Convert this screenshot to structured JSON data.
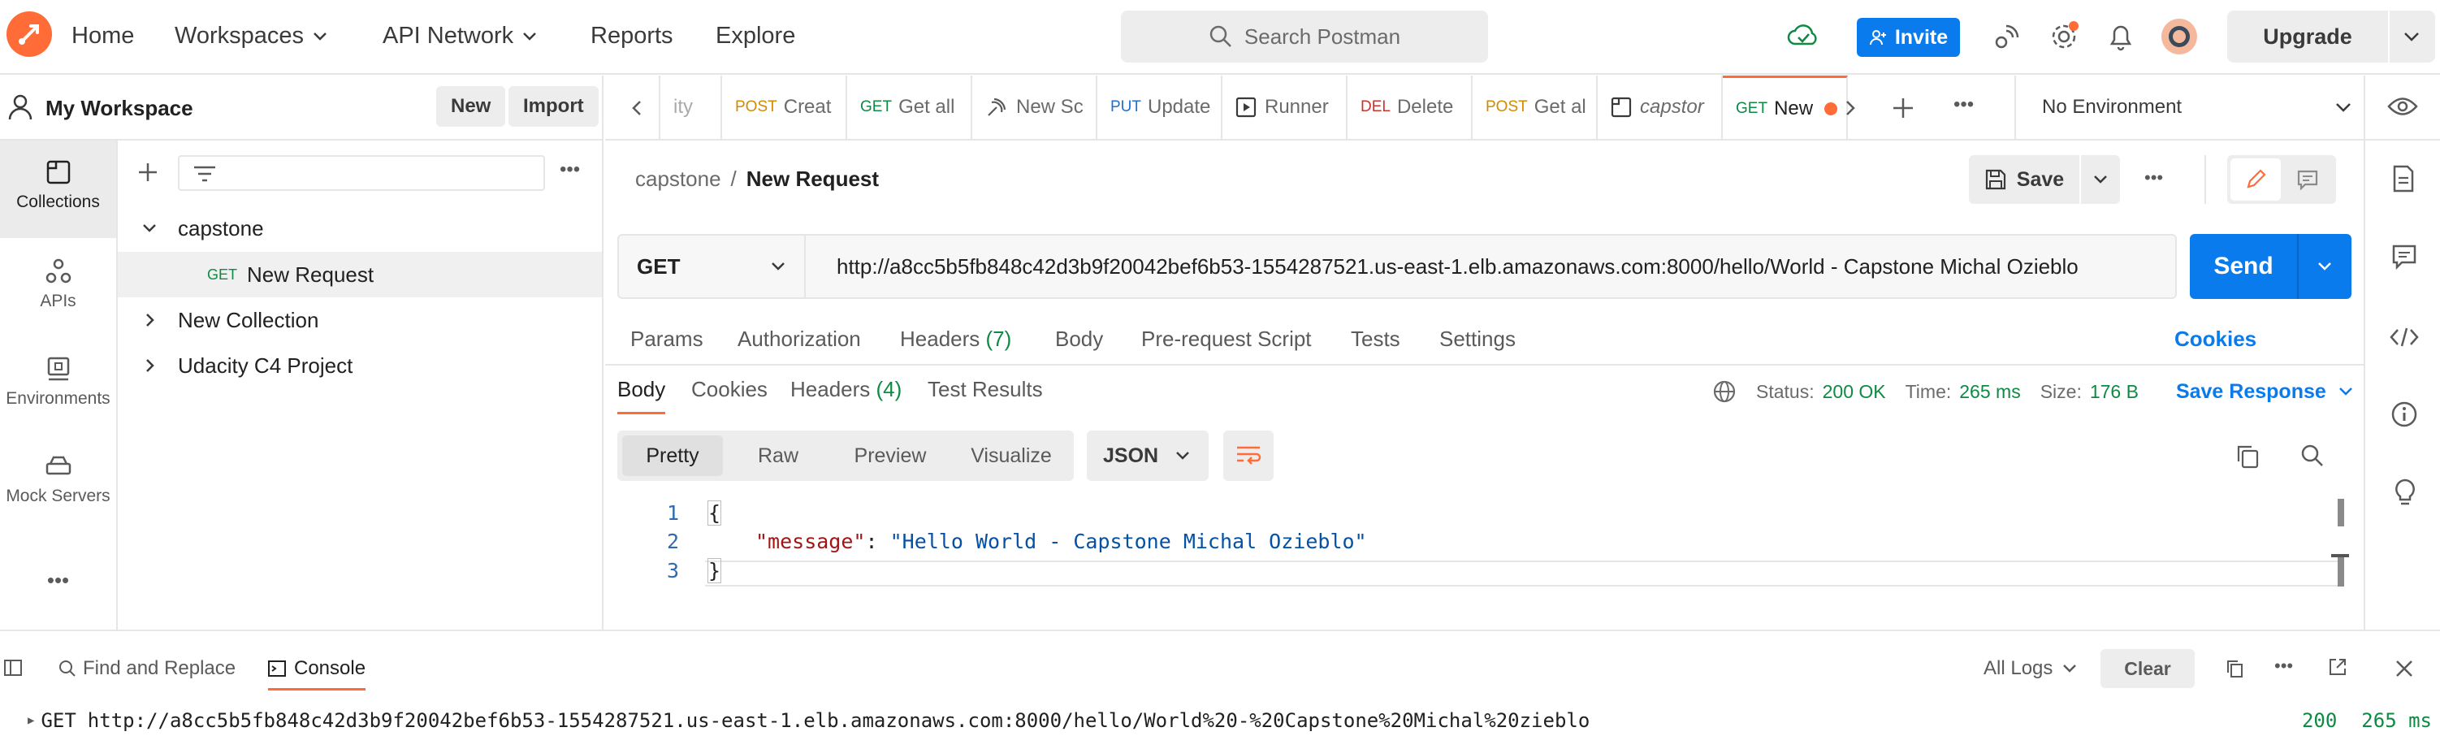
{
  "topbar": {
    "nav": [
      "Home",
      "Workspaces",
      "API Network",
      "Reports",
      "Explore"
    ],
    "search_placeholder": "Search Postman",
    "invite_label": "Invite",
    "upgrade_label": "Upgrade"
  },
  "workspace": {
    "name": "My Workspace",
    "new_label": "New",
    "import_label": "Import"
  },
  "rail": [
    "Collections",
    "APIs",
    "Environments",
    "Mock Servers"
  ],
  "tree": {
    "collections": [
      "capstone",
      "New Collection",
      "Udacity C4 Project"
    ],
    "request_method": "GET",
    "request_name": "New Request"
  },
  "tabs": [
    {
      "method": "",
      "label": "ity"
    },
    {
      "method": "POST",
      "label": "Creat"
    },
    {
      "method": "GET",
      "label": "Get all"
    },
    {
      "method": "",
      "label": "New Sc"
    },
    {
      "method": "PUT",
      "label": "Update"
    },
    {
      "method": "",
      "label": "Runner"
    },
    {
      "method": "DEL",
      "label": "Delete"
    },
    {
      "method": "POST",
      "label": "Get al"
    },
    {
      "method": "",
      "label": "capstor"
    },
    {
      "method": "GET",
      "label": "New"
    }
  ],
  "environment": "No Environment",
  "breadcrumb": {
    "collection": "capstone",
    "separator": "/",
    "request": "New Request"
  },
  "save_label": "Save",
  "request": {
    "method": "GET",
    "url": "http://a8cc5b5fb848c42d3b9f20042bef6b53-1554287521.us-east-1.elb.amazonaws.com:8000/hello/World - Capstone Michal Ozieblo",
    "send_label": "Send"
  },
  "req_tabs": {
    "params": "Params",
    "authorization": "Authorization",
    "headers": "Headers",
    "headers_count": "(7)",
    "body": "Body",
    "prerequest": "Pre-request Script",
    "tests": "Tests",
    "settings": "Settings",
    "cookies": "Cookies"
  },
  "resp_tabs": {
    "body": "Body",
    "cookies": "Cookies",
    "headers": "Headers",
    "headers_count": "(4)",
    "test_results": "Test Results"
  },
  "response_meta": {
    "status_label": "Status:",
    "status": "200 OK",
    "time_label": "Time:",
    "time": "265 ms",
    "size_label": "Size:",
    "size": "176 B",
    "save_response": "Save Response"
  },
  "view_modes": [
    "Pretty",
    "Raw",
    "Preview",
    "Visualize"
  ],
  "format": "JSON",
  "code": {
    "line_numbers": [
      "1",
      "2",
      "3"
    ],
    "open_brace": "{",
    "key": "\"message\"",
    "colon": ":",
    "value": "\"Hello World - Capstone Michal Ozieblo\"",
    "close_brace": "}"
  },
  "console": {
    "find_replace": "Find and Replace",
    "console_tab": "Console",
    "all_logs": "All Logs",
    "clear": "Clear",
    "log_method": "GET",
    "log_url": "http://a8cc5b5fb848c42d3b9f20042bef6b53-1554287521.us-east-1.elb.amazonaws.com:8000/hello/World%20-%20Capstone%20Michal%20zieblo",
    "log_status": "200",
    "log_time": "265 ms"
  },
  "colors": {
    "accent": "#ff6c37",
    "primary": "#097bed",
    "success": "#0f8a44"
  }
}
